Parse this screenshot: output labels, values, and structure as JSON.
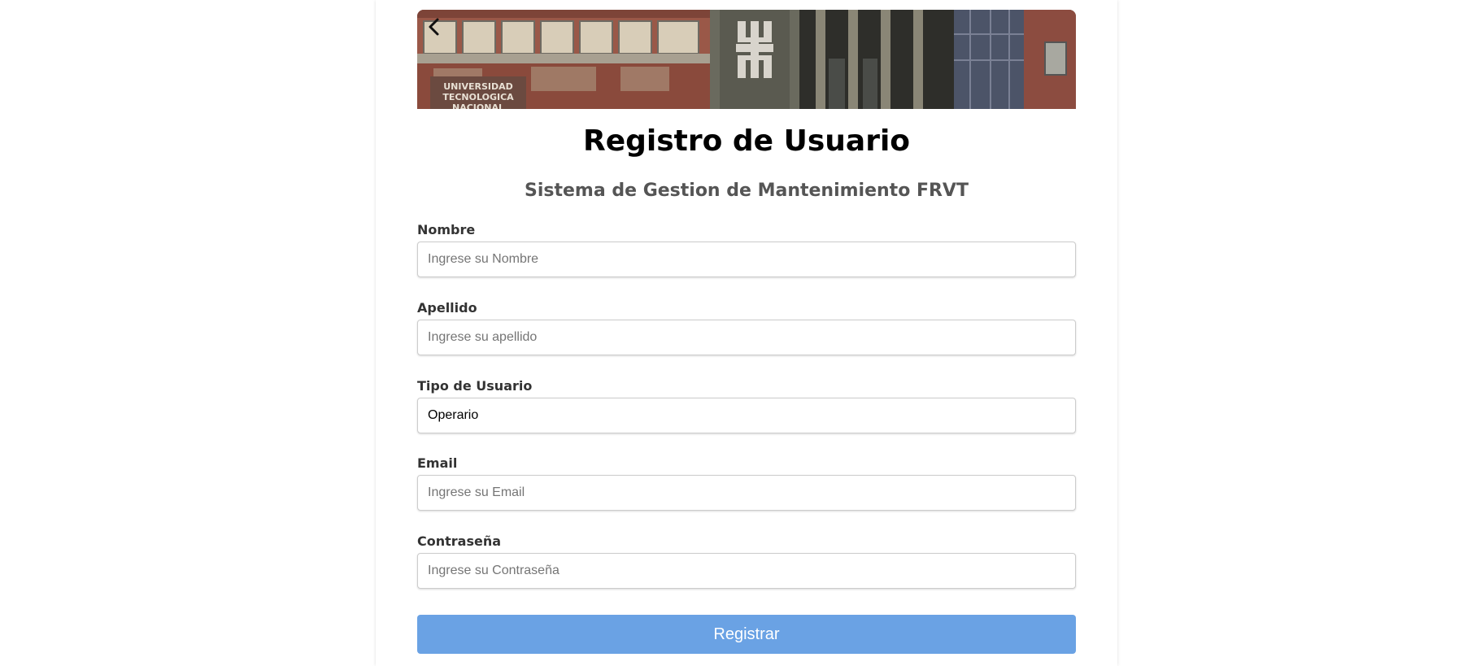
{
  "banner": {
    "image_label": "campus-building-photo",
    "sign_text": [
      "UNIVERSIDAD",
      "TECNOLOGICA",
      "NACIONAL"
    ]
  },
  "back_icon": "chevron-left-icon",
  "page": {
    "title": "Registro de Usuario",
    "subtitle": "Sistema de Gestion de Mantenimiento FRVT"
  },
  "form": {
    "nombre": {
      "label": "Nombre",
      "placeholder": "Ingrese su Nombre",
      "value": ""
    },
    "apellido": {
      "label": "Apellido",
      "placeholder": "Ingrese su apellido",
      "value": ""
    },
    "tipo_usuario": {
      "label": "Tipo de Usuario",
      "selected": "Operario"
    },
    "email": {
      "label": "Email",
      "placeholder": "Ingrese su Email",
      "value": ""
    },
    "contrasena": {
      "label": "Contraseña",
      "placeholder": "Ingrese su Contraseña",
      "value": ""
    },
    "submit_label": "Registrar"
  },
  "colors": {
    "accent": "#6aa2e4",
    "title": "#000000",
    "subtitle": "#555555"
  }
}
